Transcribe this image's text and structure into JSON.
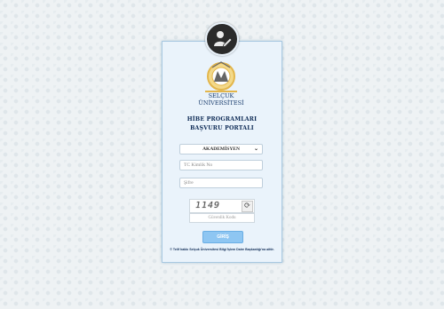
{
  "logo": {
    "line1": "SELÇUK",
    "line2": "ÜNİVERSİTESİ"
  },
  "title": {
    "line1": "HİBE PROGRAMLARI",
    "line2": "BAŞVURU PORTALI"
  },
  "form": {
    "role_selected": "AKADEMİSYEN",
    "tc_placeholder": "TC Kimlik No",
    "password_placeholder": "Şifre",
    "captcha_code": "1149",
    "captcha_placeholder": "Güvenlik Kodu",
    "login_label": "GİRİŞ"
  },
  "footer": {
    "copyright": "© Telif hakkı Selçuk Üniversitesi Bilgi İşlem Daire Başkanlığı'na aittir."
  },
  "colors": {
    "accent": "#8ec6f2",
    "brand_gold": "#e3b64b",
    "title": "#0d2a55",
    "card_bg": "#eaf3fb"
  },
  "icons": {
    "avatar": "user-edit-icon",
    "refresh": "refresh-icon",
    "chevron": "chevron-down-icon"
  }
}
